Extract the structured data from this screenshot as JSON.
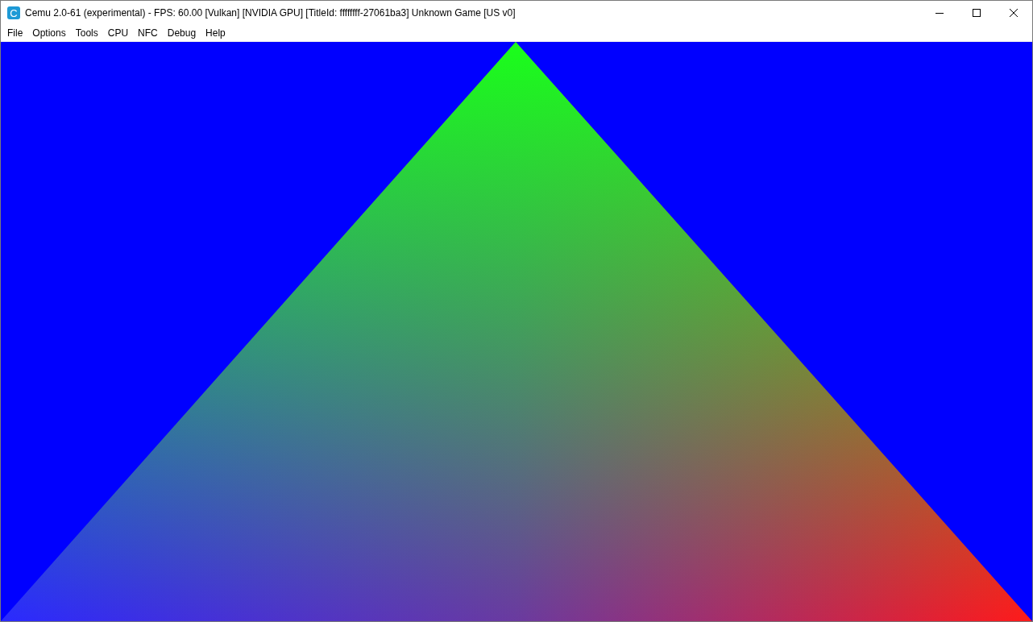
{
  "window": {
    "title": "Cemu 2.0-61 (experimental) - FPS: 60.00 [Vulkan] [NVIDIA GPU] [TitleId: ffffffff-27061ba3] Unknown Game [US v0]",
    "app_letter": "C"
  },
  "menu": [
    "File",
    "Options",
    "Tools",
    "CPU",
    "NFC",
    "Debug",
    "Help"
  ]
}
